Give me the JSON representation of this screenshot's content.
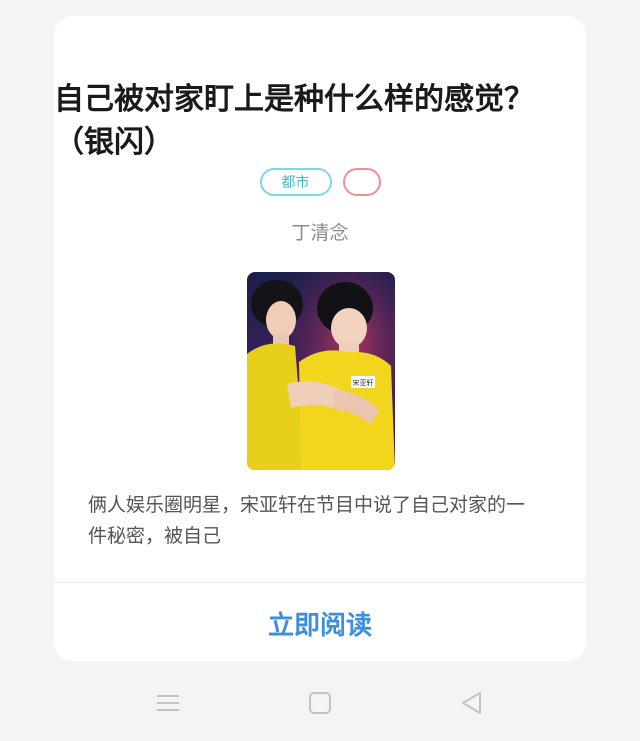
{
  "book": {
    "title": "自己被对家盯上是种什么样的感觉？（银闪）",
    "tags": [
      "都市",
      ""
    ],
    "author": "丁清念",
    "cover_alt": "book-cover-image",
    "cover_badge": "宋亚轩",
    "summary": "俩人娱乐圈明星，宋亚轩在节目中说了自己对家的一件秘密，被自己"
  },
  "actions": {
    "read_label": "立即阅读"
  },
  "nav": {
    "menu_icon": "menu-icon",
    "home_icon": "home-icon",
    "back_icon": "back-icon"
  },
  "colors": {
    "accent": "#3c8ee0",
    "tag_genre": "#7fd6e6",
    "tag_second": "#f08f97",
    "cover_shirt": "#f2d61e"
  }
}
